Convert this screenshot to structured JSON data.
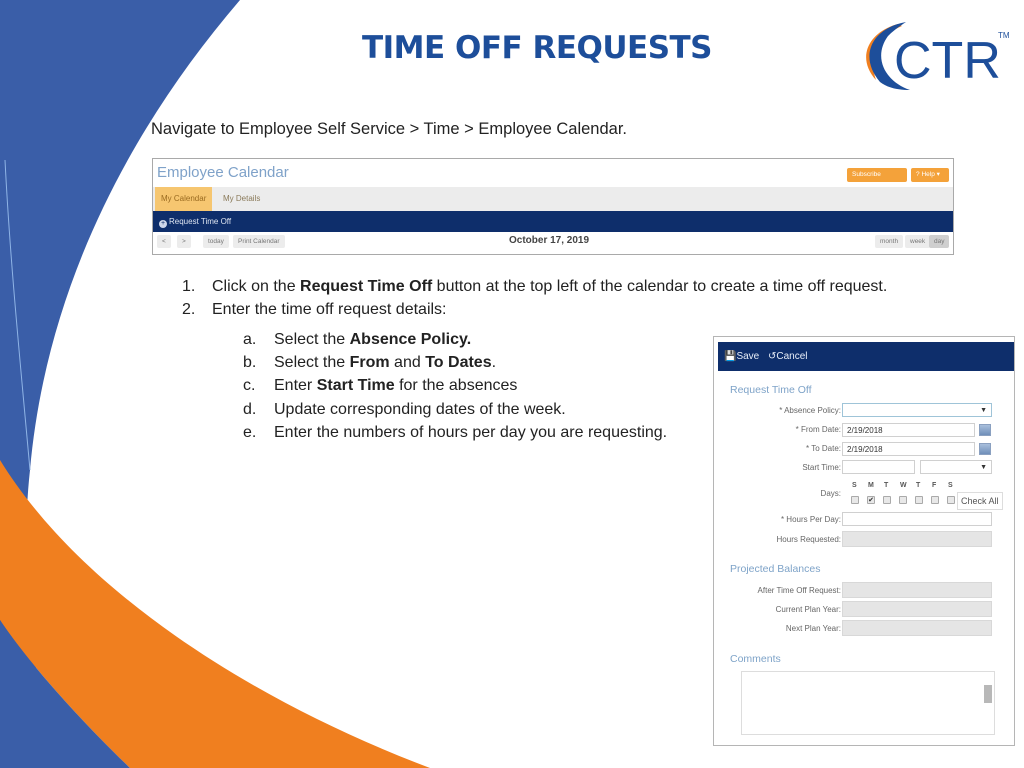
{
  "slide": {
    "title": "TIME OFF REQUESTS",
    "logo_text": "CTR",
    "logo_trademark": "TM",
    "colors": {
      "blue": "#3a5ea8",
      "orange": "#f07f1f",
      "title_blue": "#1d4e9a",
      "nav_bar": "#0e2e6b"
    },
    "navigation_instruction": "Navigate to Employee Self Service > Time > Employee Calendar."
  },
  "calendar_screenshot": {
    "title": "Employee Calendar",
    "orange_buttons": [
      "Subscribe",
      "Help"
    ],
    "tabs": [
      {
        "label": "My Calendar",
        "active": true
      },
      {
        "label": "My Details",
        "active": false
      }
    ],
    "action_button": "Request Time Off",
    "toolbar": {
      "prev": "<",
      "next": ">",
      "today": "today",
      "print": "Print Calendar"
    },
    "current_date": "October 17, 2019",
    "view_buttons": [
      "month",
      "week",
      "day"
    ]
  },
  "steps": [
    {
      "num": "1.",
      "pre": "Click on the ",
      "bold": "Request Time Off",
      "post": " button at the top left of the calendar to create a time off request."
    },
    {
      "num": "2.",
      "pre": "Enter the time off request details:",
      "bold": "",
      "post": ""
    }
  ],
  "substeps": [
    {
      "num": "a.",
      "pre": "Select the ",
      "bold": "Absence Policy.",
      "mid": "",
      "bold2": "",
      "post": ""
    },
    {
      "num": "b.",
      "pre": "Select the ",
      "bold": "From",
      "mid": " and ",
      "bold2": "To Dates",
      "post": "."
    },
    {
      "num": "c.",
      "pre": "Enter ",
      "bold": "Start Time",
      "mid": "",
      "bold2": "",
      "post": " for the absences"
    },
    {
      "num": "d.",
      "pre": "Update corresponding dates of the week.",
      "bold": "",
      "mid": "",
      "bold2": "",
      "post": ""
    },
    {
      "num": "e.",
      "pre": "Enter the numbers of hours per day you are requesting.",
      "bold": "",
      "mid": "",
      "bold2": "",
      "post": ""
    }
  ],
  "form": {
    "save_label": "Save",
    "cancel_label": "Cancel",
    "section_request": "Request Time Off",
    "absence_policy_label": "* Absence Policy:",
    "absence_policy_value": "",
    "from_date_label": "* From Date:",
    "from_date_value": "2/19/2018",
    "to_date_label": "* To Date:",
    "to_date_value": "2/19/2018",
    "start_time_label": "Start Time:",
    "start_time_value": "",
    "start_time_period": "",
    "days_label": "Days:",
    "days": [
      {
        "letter": "S",
        "checked": false
      },
      {
        "letter": "M",
        "checked": true
      },
      {
        "letter": "T",
        "checked": false
      },
      {
        "letter": "W",
        "checked": false
      },
      {
        "letter": "T",
        "checked": false
      },
      {
        "letter": "F",
        "checked": false
      },
      {
        "letter": "S",
        "checked": false
      }
    ],
    "check_all_label": "Check All",
    "hours_per_day_label": "* Hours Per Day:",
    "hours_per_day_value": "",
    "hours_requested_label": "Hours Requested:",
    "section_balances": "Projected Balances",
    "after_request_label": "After Time Off Request:",
    "current_plan_label": "Current Plan Year:",
    "next_plan_label": "Next Plan Year:",
    "section_comments": "Comments",
    "comments_value": ""
  }
}
